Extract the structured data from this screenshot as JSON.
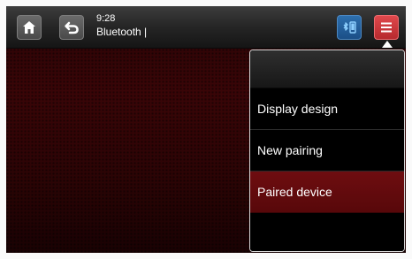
{
  "status": {
    "time": "9:28",
    "source": "Bluetooth |"
  },
  "icons": {
    "home": "home-icon",
    "back": "back-icon",
    "bluetooth": "bluetooth-phone-icon",
    "menu": "hamburger-menu-icon"
  },
  "menu": {
    "items": [
      {
        "label": "Display design"
      },
      {
        "label": "New pairing"
      },
      {
        "label": "Paired device",
        "selected": true
      }
    ]
  },
  "colors": {
    "accent_red": "#d83a3f",
    "bluetooth_blue": "#2d6fae",
    "selected_row": "#6e0d10"
  }
}
